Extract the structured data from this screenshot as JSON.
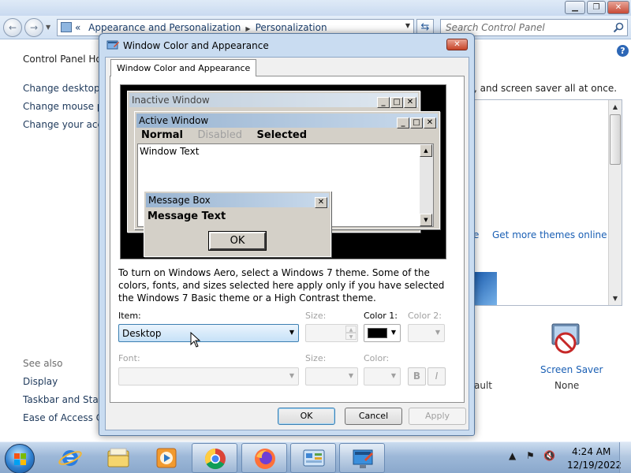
{
  "explorer": {
    "address_root_chevron": "«",
    "breadcrumb": [
      "Appearance and Personalization",
      "Personalization"
    ],
    "search_placeholder": "Search Control Panel",
    "left_nav": {
      "home": "Control Panel Hor",
      "links": [
        "Change desktop ic",
        "Change mouse po",
        "Change your acco"
      ]
    },
    "see_also": {
      "heading": "See also",
      "links": [
        "Display",
        "Taskbar and Start I",
        "Ease of Access Cen"
      ]
    },
    "content_text": ", and screen saver all at once.",
    "e_fragment": "e",
    "get_more_link": "Get more themes online",
    "ault_fragment": "ault",
    "screen_saver": {
      "label": "Screen Saver",
      "value": "None"
    }
  },
  "dialog": {
    "title": "Window Color and Appearance",
    "tab_label": "Window Color and Appearance",
    "preview": {
      "inactive_title": "Inactive Window",
      "active_title": "Active Window",
      "menu": {
        "normal": "Normal",
        "disabled": "Disabled",
        "selected": "Selected"
      },
      "window_text": "Window Text",
      "message_box_title": "Message Box",
      "message_text": "Message Text",
      "ok_label": "OK"
    },
    "instructions": "To turn on Windows Aero, select a Windows 7 theme.  Some of the colors, fonts, and sizes selected here apply only if you have selected the Windows 7 Basic theme or a High Contrast theme.",
    "item_label": "Item:",
    "item_value": "Desktop",
    "size_label": "Size:",
    "color1_label": "Color 1:",
    "color1_value": "#000000",
    "color2_label": "Color 2:",
    "font_label": "Font:",
    "font_size_label": "Size:",
    "font_color_label": "Color:",
    "bold_label": "B",
    "italic_label": "I",
    "ok_button": "OK",
    "cancel_button": "Cancel",
    "apply_button": "Apply"
  },
  "taskbar": {
    "items": [
      "internet-explorer",
      "windows-explorer",
      "media-player",
      "chrome",
      "firefox",
      "control-panel",
      "personalization"
    ],
    "clock_time": "4:24 AM",
    "clock_date": "12/19/2022"
  }
}
